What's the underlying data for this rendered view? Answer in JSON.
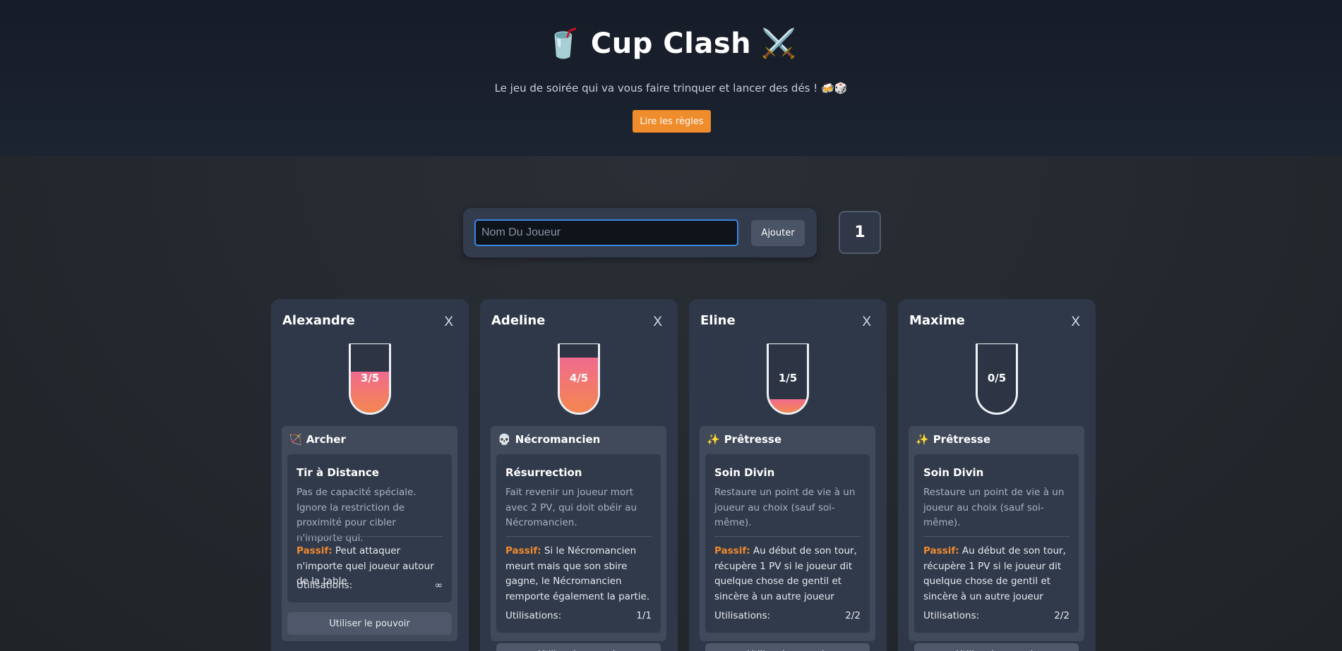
{
  "header": {
    "title_left_icon": "🥤",
    "title": "Cup Clash",
    "title_right_icon": "⚔️",
    "subtitle": "Le jeu de soirée qui va vous faire trinquer et lancer des dés ! 🍻🎲",
    "rules_button": "Lire les règles"
  },
  "add_player": {
    "placeholder": "Nom Du Joueur",
    "value": "",
    "add_button": "Ajouter",
    "counter": "1"
  },
  "colors": {
    "accent": "#ef8c2c",
    "input_focus": "#3b86e0",
    "liquid_top": "#f06b8e",
    "liquid_bottom": "#f4874f"
  },
  "players": [
    {
      "name": "Alexandre",
      "close": "X",
      "hp_label": "3/5",
      "hp_fraction": 0.6,
      "class_icon": "🏹",
      "class_name": "Archer",
      "power_title": "Tir à Distance",
      "power_desc": "Pas de capacité spéciale. Ignore la restriction de proximité pour cibler n'importe qui.",
      "passive_label": "Passif:",
      "passive_text": "Peut attaquer n'importe quel joueur autour de la table",
      "uses_label": "Utilisations:",
      "uses_value": "∞",
      "use_button": "Utiliser le pouvoir"
    },
    {
      "name": "Adeline",
      "close": "X",
      "hp_label": "4/5",
      "hp_fraction": 0.8,
      "class_icon": "💀",
      "class_name": "Nécromancien",
      "power_title": "Résurrection",
      "power_desc": "Fait revenir un joueur mort avec 2 PV, qui doit obéir au Nécromancien.",
      "passive_label": "Passif:",
      "passive_text": "Si le Nécromancien meurt mais que son sbire gagne, le Nécromancien remporte également la partie.",
      "uses_label": "Utilisations:",
      "uses_value": "1/1",
      "use_button": "Utiliser le pouvoir"
    },
    {
      "name": "Eline",
      "close": "X",
      "hp_label": "1/5",
      "hp_fraction": 0.2,
      "class_icon": "✨",
      "class_name": "Prêtresse",
      "power_title": "Soin Divin",
      "power_desc": "Restaure un point de vie à un joueur au choix (sauf soi-même).",
      "passive_label": "Passif:",
      "passive_text": "Au début de son tour, récupère 1 PV si le joueur dit quelque chose de gentil et sincère à un autre joueur",
      "uses_label": "Utilisations:",
      "uses_value": "2/2",
      "use_button": "Utiliser le pouvoir"
    },
    {
      "name": "Maxime",
      "close": "X",
      "hp_label": "0/5",
      "hp_fraction": 0,
      "class_icon": "✨",
      "class_name": "Prêtresse",
      "power_title": "Soin Divin",
      "power_desc": "Restaure un point de vie à un joueur au choix (sauf soi-même).",
      "passive_label": "Passif:",
      "passive_text": "Au début de son tour, récupère 1 PV si le joueur dit quelque chose de gentil et sincère à un autre joueur",
      "uses_label": "Utilisations:",
      "uses_value": "2/2",
      "use_button": "Utiliser le pouvoir"
    }
  ]
}
